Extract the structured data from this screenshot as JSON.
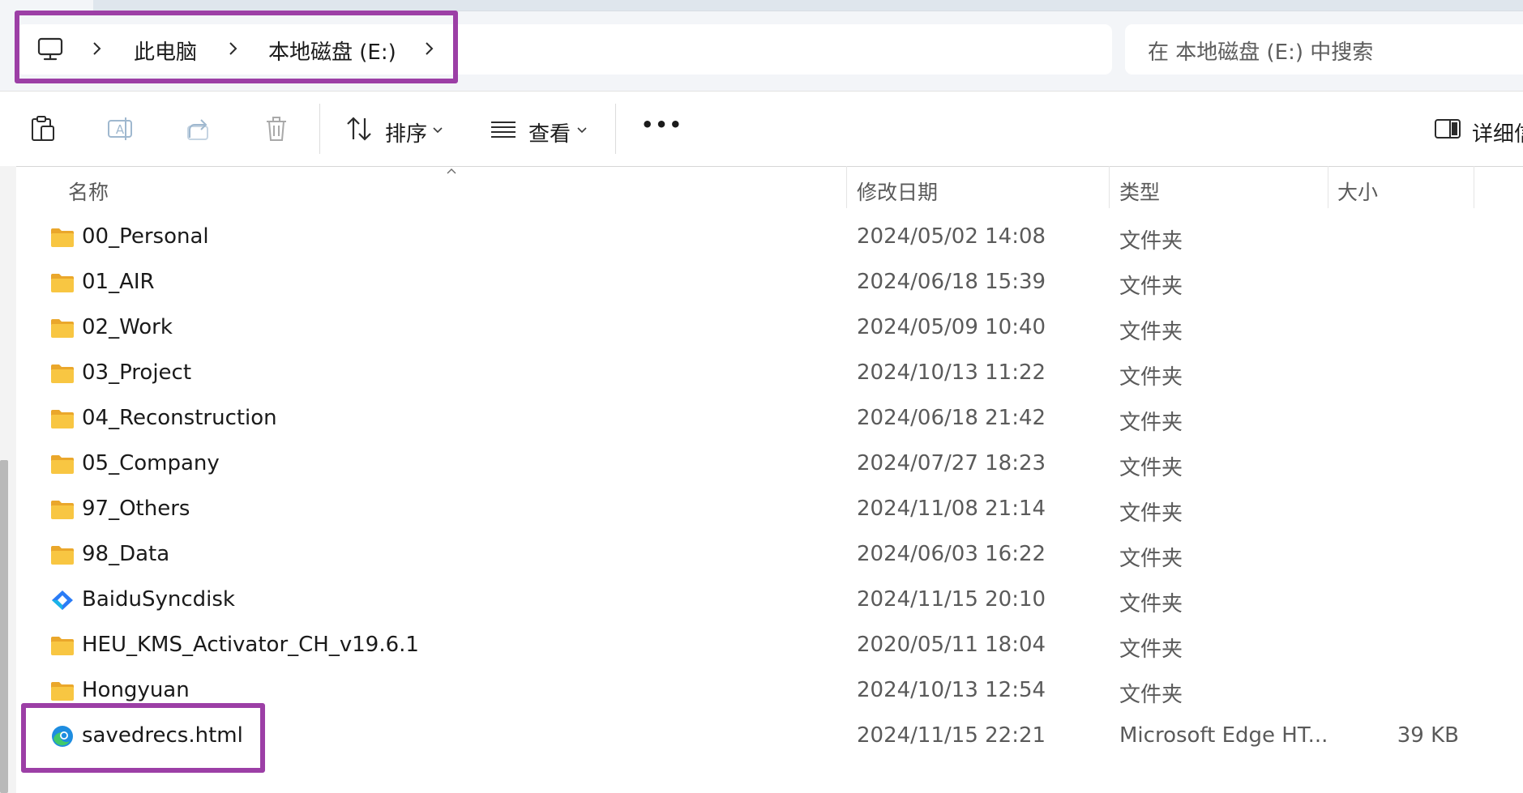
{
  "breadcrumb": {
    "items": [
      {
        "label": "此电脑"
      },
      {
        "label": "本地磁盘 (E:)"
      }
    ]
  },
  "search": {
    "placeholder": "在 本地磁盘 (E:) 中搜索"
  },
  "toolbar": {
    "sort_label": "排序",
    "view_label": "查看",
    "more_label": "•••",
    "details_label": "详细信"
  },
  "columns": {
    "name": "名称",
    "modified": "修改日期",
    "type": "类型",
    "size": "大小"
  },
  "files": [
    {
      "name": "00_Personal",
      "modified": "2024/05/02 14:08",
      "type": "文件夹",
      "size": "",
      "icon": "folder-icon"
    },
    {
      "name": "01_AIR",
      "modified": "2024/06/18 15:39",
      "type": "文件夹",
      "size": "",
      "icon": "folder-icon"
    },
    {
      "name": "02_Work",
      "modified": "2024/05/09 10:40",
      "type": "文件夹",
      "size": "",
      "icon": "folder-icon"
    },
    {
      "name": "03_Project",
      "modified": "2024/10/13 11:22",
      "type": "文件夹",
      "size": "",
      "icon": "folder-icon"
    },
    {
      "name": "04_Reconstruction",
      "modified": "2024/06/18 21:42",
      "type": "文件夹",
      "size": "",
      "icon": "folder-icon"
    },
    {
      "name": "05_Company",
      "modified": "2024/07/27 18:23",
      "type": "文件夹",
      "size": "",
      "icon": "folder-icon"
    },
    {
      "name": "97_Others",
      "modified": "2024/11/08 21:14",
      "type": "文件夹",
      "size": "",
      "icon": "folder-icon"
    },
    {
      "name": "98_Data",
      "modified": "2024/06/03 16:22",
      "type": "文件夹",
      "size": "",
      "icon": "folder-icon"
    },
    {
      "name": "BaiduSyncdisk",
      "modified": "2024/11/15 20:10",
      "type": "文件夹",
      "size": "",
      "icon": "baidu-sync-icon"
    },
    {
      "name": "HEU_KMS_Activator_CH_v19.6.1",
      "modified": "2020/05/11 18:04",
      "type": "文件夹",
      "size": "",
      "icon": "folder-icon"
    },
    {
      "name": "Hongyuan",
      "modified": "2024/10/13 12:54",
      "type": "文件夹",
      "size": "",
      "icon": "folder-icon"
    },
    {
      "name": "savedrecs.html",
      "modified": "2024/11/15 22:21",
      "type": "Microsoft Edge HT...",
      "size": "39 KB",
      "icon": "edge-icon"
    }
  ],
  "colors": {
    "highlight": "#9c3fa6",
    "folder": "#f8c642",
    "folder_dark": "#eaa72b"
  }
}
